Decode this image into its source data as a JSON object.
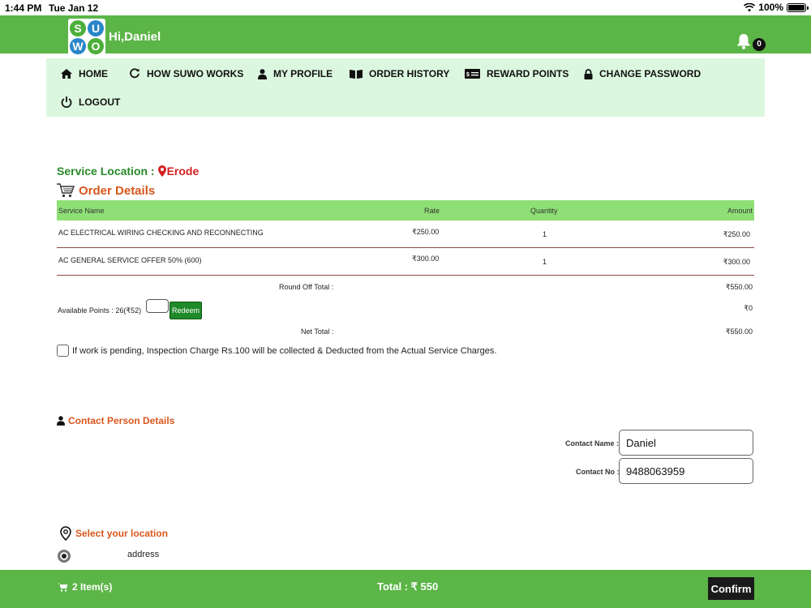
{
  "statusbar": {
    "time": "1:44 PM",
    "date": "Tue Jan 12",
    "battery": "100%"
  },
  "header": {
    "greeting": "Hi,Daniel",
    "notification_count": "0",
    "logo_letters": [
      "S",
      "U",
      "W",
      "O"
    ]
  },
  "nav": [
    {
      "label": "HOME",
      "icon": "home-icon"
    },
    {
      "label": "HOW SUWO WORKS",
      "icon": "refresh-icon"
    },
    {
      "label": "MY PROFILE",
      "icon": "user-icon"
    },
    {
      "label": "ORDER HISTORY",
      "icon": "book-icon"
    },
    {
      "label": "REWARD POINTS",
      "icon": "money-icon"
    },
    {
      "label": "CHANGE PASSWORD",
      "icon": "lock-icon"
    },
    {
      "label": "LOGOUT",
      "icon": "power-icon"
    }
  ],
  "service_location": {
    "label": "Service Location :",
    "city": "Erode"
  },
  "order": {
    "title": "Order Details",
    "headers": {
      "name": "Service Name",
      "rate": "Rate",
      "quantity": "Quantity",
      "amount": "Amount"
    },
    "rows": [
      {
        "name": "AC ELECTRICAL WIRING CHECKING AND RECONNECTING",
        "rate": "₹250.00",
        "quantity": "1",
        "amount": "₹250.00"
      },
      {
        "name": "AC GENERAL SERVICE OFFER 50% (600)",
        "rate": "₹300.00",
        "quantity": "1",
        "amount": "₹300.00"
      }
    ],
    "round_off_label": "Round Off Total :",
    "round_off_value": "₹550.00",
    "available_points": "Available Points : 26(₹52)",
    "redeem_label": "Redeem",
    "discount_value": "₹0",
    "net_total_label": "Net Total :",
    "net_total_value": "₹550.00"
  },
  "inspection_notice": "If work is pending, Inspection Charge Rs.100 will be collected & Deducted from the Actual Service Charges.",
  "contact": {
    "title": "Contact Person Details",
    "name_label": "Contact Name :",
    "name_value": "Daniel",
    "phone_label": "Contact No :",
    "phone_value": "9488063959"
  },
  "location": {
    "title": "Select your location",
    "address": "address"
  },
  "footer": {
    "items": "2 Item(s)",
    "total": "Total : ₹ 550",
    "confirm": "Confirm"
  },
  "colors": {
    "brand_green": "#5cb547",
    "nav_bg": "#dcf7df",
    "table_header": "#8edf76",
    "accent_orange": "#d9561c",
    "location_green": "#2a8a28",
    "city_red": "#d32020"
  }
}
